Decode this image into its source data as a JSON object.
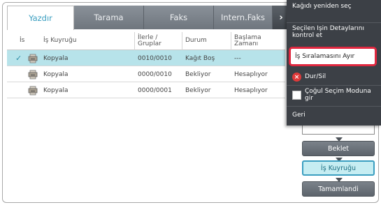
{
  "tabs": [
    {
      "label": "Yazdır",
      "active": true
    },
    {
      "label": "Tarama",
      "active": false
    },
    {
      "label": "Faks",
      "active": false
    },
    {
      "label": "Intern.Faks",
      "active": false
    }
  ],
  "table": {
    "headers": {
      "is": "İs",
      "queue": "İş Kuyruğu",
      "progress": "İlerle / Gruplar",
      "status": "Durum",
      "start": "Başlama Zamanı"
    },
    "rows": [
      {
        "queue": "Kopyala",
        "progress": "0010/0010",
        "status": "Kağıt Boş",
        "start": "---",
        "selected": true
      },
      {
        "queue": "Kopyala",
        "progress": "0000/0010",
        "status": "Bekliyor",
        "start": "Hesaplıyor",
        "selected": false
      },
      {
        "queue": "Kopyala",
        "progress": "0000/0001",
        "status": "Bekliyor",
        "start": "Hesaplıyor",
        "selected": false
      }
    ]
  },
  "menu": {
    "items": [
      {
        "label": "Kağıdı yeniden seç"
      },
      {
        "label": "Seçilen İşin Detaylarını kontrol et"
      },
      {
        "label": "İş Sıralamasını Ayır",
        "highlighted": true
      },
      {
        "label": "Dur/Sil",
        "icon": "stop-icon"
      },
      {
        "label": "Çoğul Seçim Moduna gir",
        "icon": "checkbox-icon"
      },
      {
        "label": "Geri"
      }
    ]
  },
  "panel": {
    "hold_label": "Beklet",
    "queue_label": "İş Kuyruğu",
    "completed_label": "Tamamlandi"
  },
  "colors": {
    "accent": "#3a9ec0",
    "selected_row": "#b7e3ea",
    "menu_bg": "#3c4046",
    "highlight_border": "#e0273f"
  }
}
